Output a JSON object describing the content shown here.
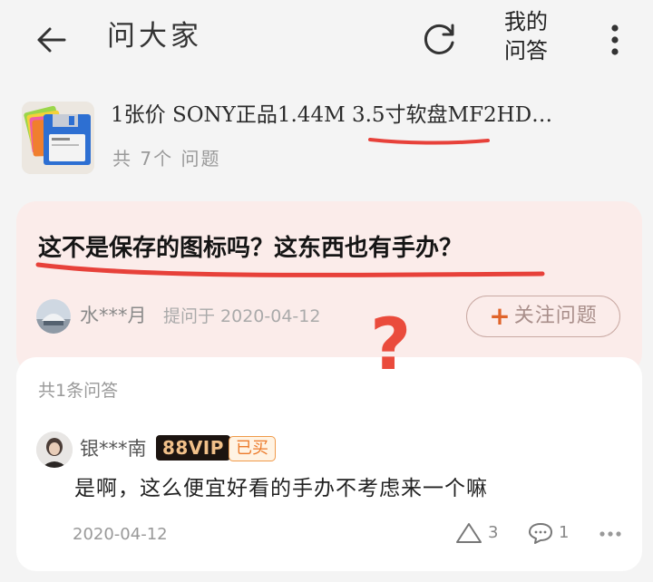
{
  "header": {
    "title": "问大家",
    "my_qa_line1": "我的",
    "my_qa_line2": "问答"
  },
  "product": {
    "title": "1张价 SONY正品1.44M 3.5寸软盘MF2HD…",
    "question_count": "共 7个 问题"
  },
  "question": {
    "text": "这不是保存的图标吗？这东西也有手办？",
    "asker_name": "水***月",
    "asked_at": "提问于 2020-04-12",
    "follow_plus": "+",
    "follow_label": "关注问题"
  },
  "annotation": {
    "question_mark": "?"
  },
  "answers": {
    "count_label": "共1条问答",
    "items": [
      {
        "user": "银***南",
        "vip_badge": "88VIP",
        "bought_badge": "已买",
        "text": "是啊，这么便宜好看的手办不考虑来一个嘛",
        "date": "2020-04-12",
        "likes": "3",
        "comments": "1"
      }
    ]
  },
  "colors": {
    "accent_orange": "#e0642a",
    "question_card_bg": "#fbecea",
    "annotation_red": "#ea4b3c",
    "vip_gold": "#f2c18a"
  },
  "icons": {
    "back": "arrow-left-icon",
    "refresh": "refresh-icon",
    "more": "more-vertical-icon",
    "like": "triangle-like-icon",
    "comment": "comment-bubble-icon",
    "answer_more": "more-horizontal-icon"
  }
}
